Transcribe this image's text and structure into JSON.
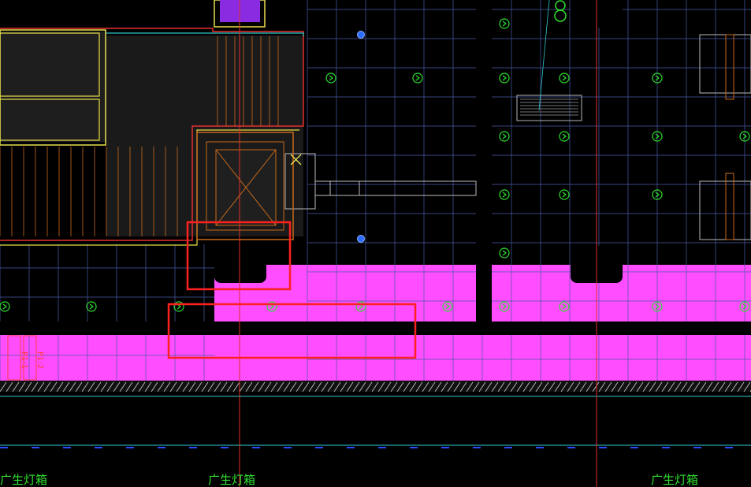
{
  "drawing": {
    "background": "#000000",
    "colors": {
      "grid": "#4a5aa8",
      "highlight_floor": "#ff4dff",
      "wall_yellow": "#e8e04a",
      "wall_red": "#e23030",
      "wall_cyan": "#30c8d0",
      "orange": "#c86a1a",
      "green": "#2fe02f",
      "blue": "#2a6cff",
      "selection_box": "#ff2020",
      "gray": "#9a9a9a"
    },
    "labels": {
      "ad_lightbox_1": "广生灯箱",
      "ad_lightbox_2": "广生灯箱",
      "ad_lightbox_3": "广生灯箱",
      "column_tag_1": "P1-1",
      "column_tag_2": "P1-2"
    },
    "icons": {
      "light_fixture": "circle-arrow-icon",
      "sprinkler": "blue-dot-icon",
      "elevator": "elevator-x-icon",
      "vent": "grille-icon",
      "cursor": "crosshair-x-icon"
    },
    "selections": {
      "count": 2
    }
  }
}
